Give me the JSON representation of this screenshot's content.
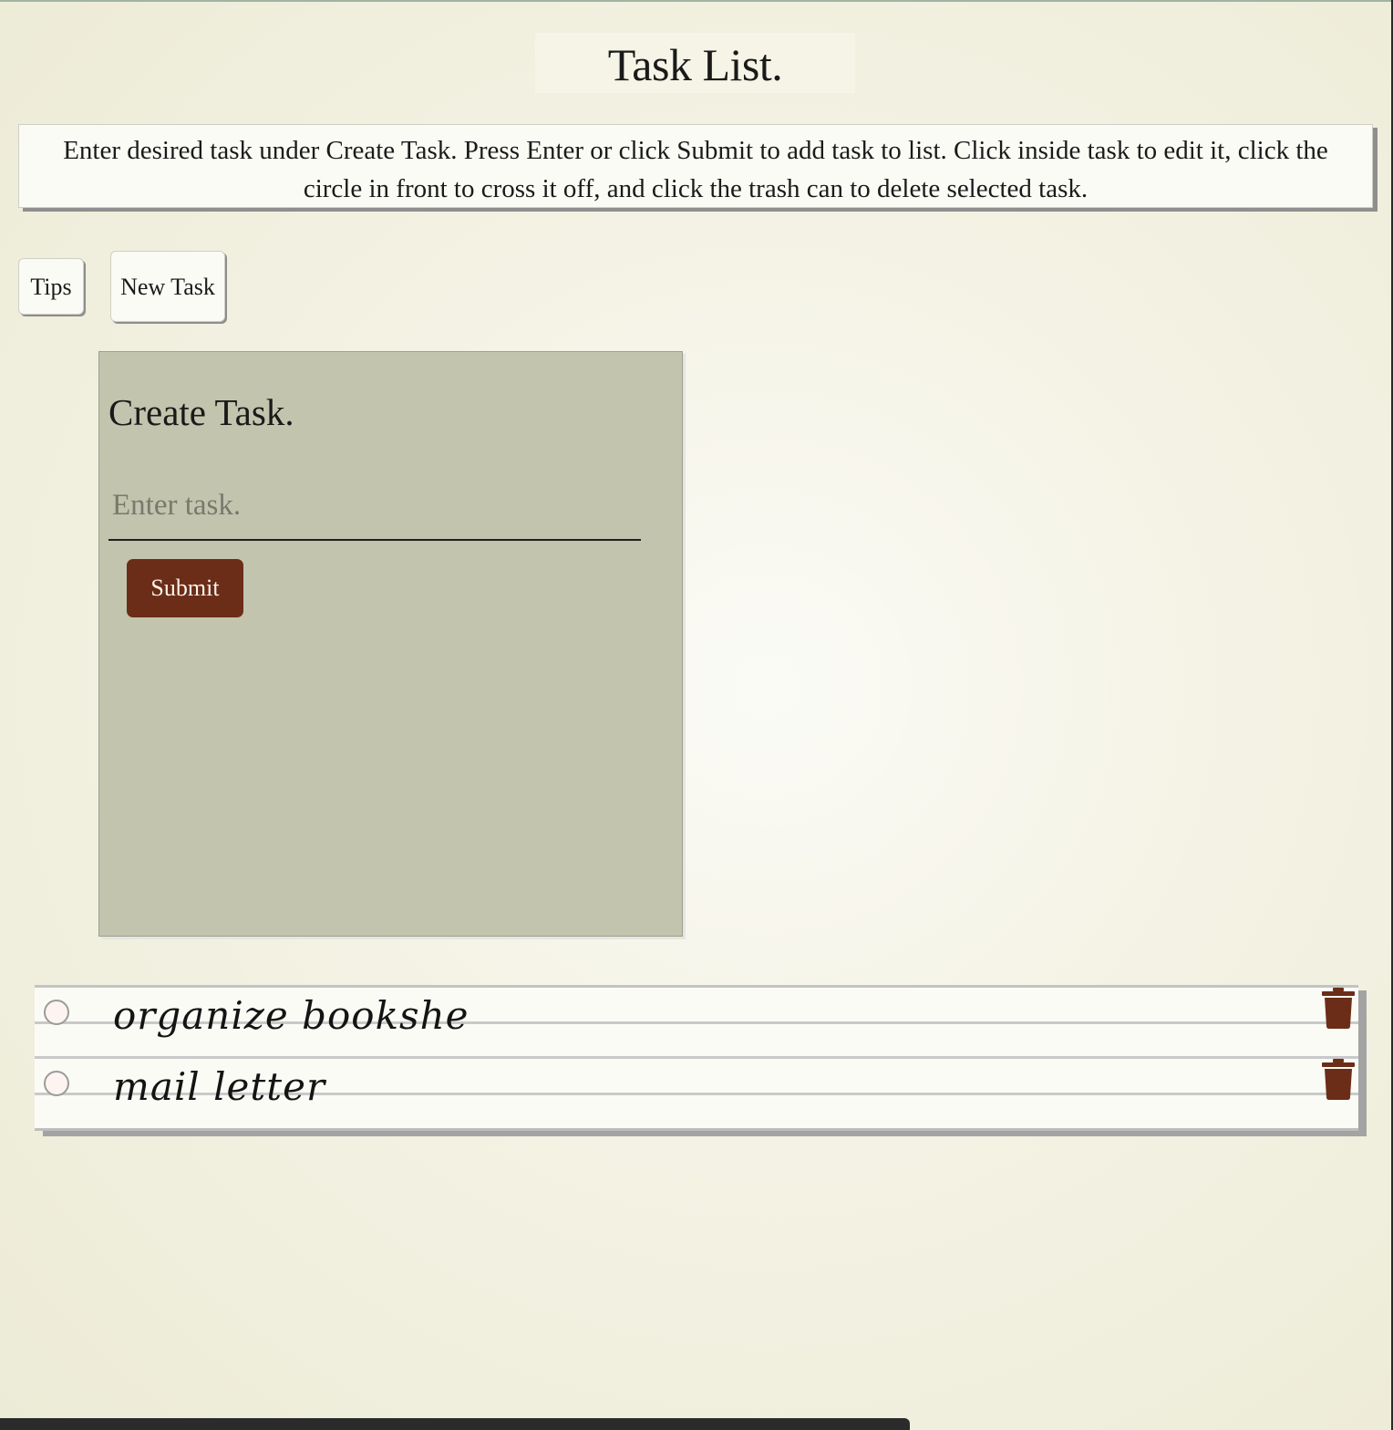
{
  "header": {
    "title": "Task List."
  },
  "instructions": {
    "text": "Enter desired task under Create Task. Press Enter or click Submit to add task to list. Click inside task to edit it, click the circle in front to cross it off, and click the trash can to delete selected task."
  },
  "toolbar": {
    "tips_label": "Tips",
    "new_task_label": "New Task"
  },
  "create_task": {
    "heading": "Create Task.",
    "input_placeholder": "Enter task.",
    "input_value": "",
    "submit_label": "Submit"
  },
  "tasks": [
    {
      "text": "organize bookshe",
      "done": false,
      "delete_icon": "trash-icon"
    },
    {
      "text": "mail letter",
      "done": false,
      "delete_icon": "trash-icon"
    }
  ],
  "colors": {
    "accent": "#6b2d17",
    "panel": "#c2c4ad",
    "background": "#f4f2e4"
  }
}
